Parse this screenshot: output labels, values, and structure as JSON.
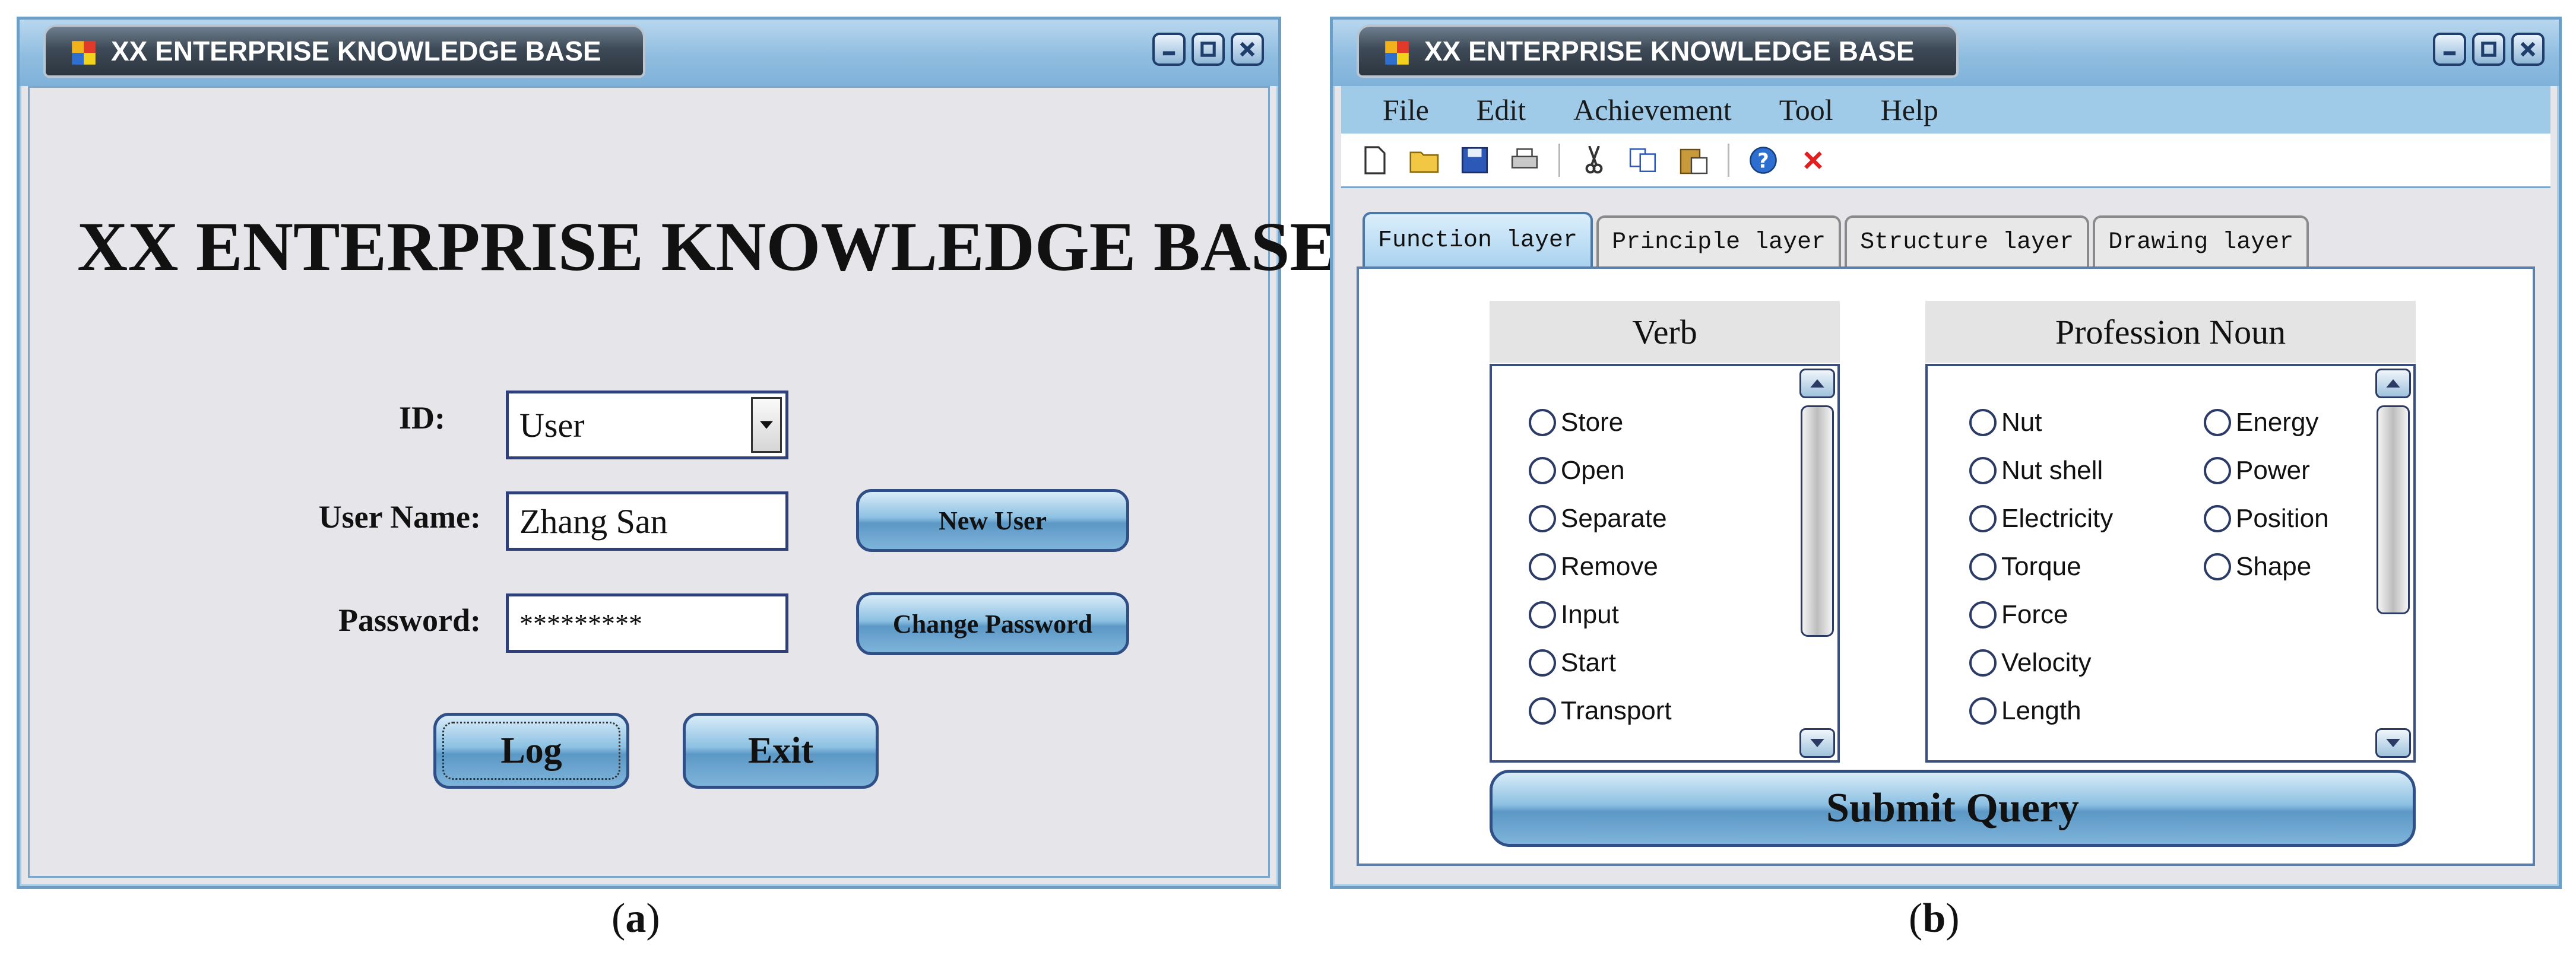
{
  "window_a": {
    "title": "XX ENTERPRISE KNOWLEDGE BASE",
    "heading": "XX ENTERPRISE KNOWLEDGE BASE",
    "id_label": "ID:",
    "id_value": "User",
    "username_label": "User Name:",
    "username_value": "Zhang San",
    "password_label": "Password:",
    "password_value": "*********",
    "new_user_label": "New User",
    "change_password_label": "Change Password",
    "log_label": "Log",
    "exit_label": "Exit"
  },
  "window_b": {
    "title": "XX ENTERPRISE KNOWLEDGE BASE",
    "menu": [
      "File",
      "Edit",
      "Achievement",
      "Tool",
      "Help"
    ],
    "toolbar_icons": [
      "new-icon",
      "open-icon",
      "save-icon",
      "print-icon",
      "cut-icon",
      "copy-icon",
      "paste-icon",
      "help-icon",
      "delete-icon"
    ],
    "tabs": [
      "Function layer",
      "Principle layer",
      "Structure layer",
      "Drawing layer"
    ],
    "active_tab": "Function layer",
    "verb_header": "Verb",
    "verbs": [
      "Store",
      "Open",
      "Separate",
      "Remove",
      "Input",
      "Start",
      "Transport"
    ],
    "noun_header": "Profession Noun",
    "nouns_col1": [
      "Nut",
      "Nut shell",
      "Electricity",
      "Torque",
      "Force",
      "Velocity",
      "Length"
    ],
    "nouns_col2": [
      "Energy",
      "Power",
      "Position",
      "Shape"
    ],
    "submit_label": "Submit Query"
  },
  "captions": {
    "a_letter": "a",
    "b_letter": "b"
  },
  "colors": {
    "title_bar": "#8fbde0",
    "button": "#7eb4da",
    "window_bg": "#e6e6ea",
    "delete_red": "#e02020"
  }
}
